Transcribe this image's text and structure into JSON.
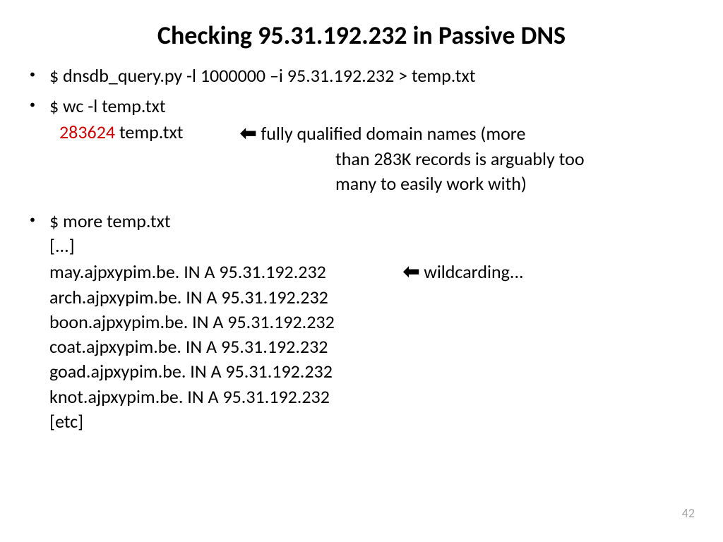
{
  "title": "Checking 95.31.192.232 in Passive DNS",
  "bullets": {
    "b1": "$ dnsdb_query.py -l 1000000 –i 95.31.192.232 > temp.txt",
    "b2": "$ wc -l temp.txt",
    "wc_count": "283624",
    "wc_file": " temp.txt",
    "arrow": "⬅",
    "fqdn_l1": " fully qualified domain names (more",
    "fqdn_l2": "than 283K records is arguably too",
    "fqdn_l3": "many to easily work with)",
    "b3": "$ more temp.txt",
    "ellipsis": "[...]",
    "dns1": "may.ajpxypim.be. IN A 95.31.192.232",
    "wild_note": " wildcarding...",
    "dns2": "arch.ajpxypim.be. IN A 95.31.192.232",
    "dns3": "boon.ajpxypim.be. IN A 95.31.192.232",
    "dns4": "coat.ajpxypim.be. IN A 95.31.192.232",
    "dns5": "goad.ajpxypim.be. IN A 95.31.192.232",
    "dns6": "knot.ajpxypim.be. IN A 95.31.192.232",
    "etc": "[etc]"
  },
  "page_number": "42"
}
